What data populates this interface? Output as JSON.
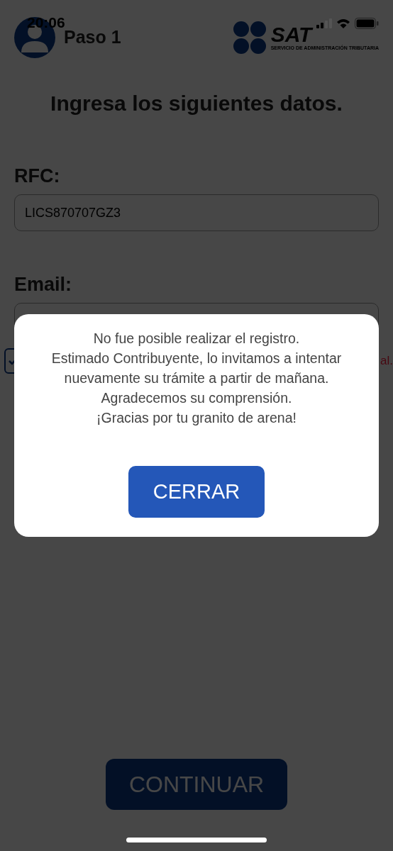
{
  "status_bar": {
    "time": "20:06"
  },
  "header": {
    "title": "Paso 1",
    "logo": {
      "name": "SAT",
      "subtitle": "SERVICIO DE ADMINISTRACIÓN TRIBUTARIA"
    }
  },
  "form": {
    "heading": "Ingresa los siguientes datos.",
    "fields": [
      {
        "label": "RFC:",
        "value": "LICS870707GZ3"
      },
      {
        "label": "Email:"
      }
    ],
    "terms": {
      "checked": true,
      "text_tail": "al."
    },
    "continue_button": "CONTINUAR"
  },
  "dialog": {
    "message": [
      "No fue posible realizar el registro.",
      "Estimado Contribuyente, lo invitamos a intentar",
      "nuevamente su trámite a partir de mañana.",
      "Agradecemos su comprensión.",
      "¡Gracias por tu granito de arena!"
    ],
    "close_button": "CERRAR"
  }
}
